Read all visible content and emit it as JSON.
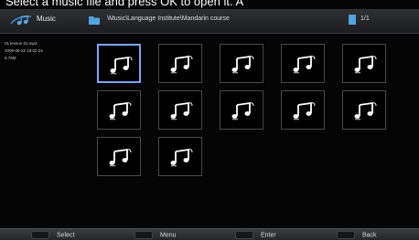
{
  "top_cut_text": "Select a music file and press OK to open it. A",
  "header": {
    "app_title": "Music",
    "path": "\\Music\\Language Institute\\Mandarin course",
    "page": "1/1"
  },
  "file_info": {
    "name": "01 lesson 01.mp3",
    "date": "2009-06-22 18:02:24",
    "size": "5.76M"
  },
  "grid": {
    "items": [
      {
        "icon": "music-note-icon",
        "selected": true
      },
      {
        "icon": "music-note-icon",
        "selected": false
      },
      {
        "icon": "music-note-icon",
        "selected": false
      },
      {
        "icon": "music-note-icon",
        "selected": false
      },
      {
        "icon": "music-note-icon",
        "selected": false
      },
      {
        "icon": "music-note-icon",
        "selected": false
      },
      {
        "icon": "music-note-icon",
        "selected": false
      },
      {
        "icon": "music-note-icon",
        "selected": false
      },
      {
        "icon": "music-note-icon",
        "selected": false
      },
      {
        "icon": "music-note-icon",
        "selected": false
      },
      {
        "icon": "music-note-icon",
        "selected": false
      },
      {
        "icon": "music-note-icon",
        "selected": false
      }
    ]
  },
  "footer": {
    "select": "Select",
    "menu": "Menu",
    "enter": "Enter",
    "back": "Back"
  },
  "colors": {
    "selection": "#7da4ff",
    "folder": "#4fa3df"
  }
}
